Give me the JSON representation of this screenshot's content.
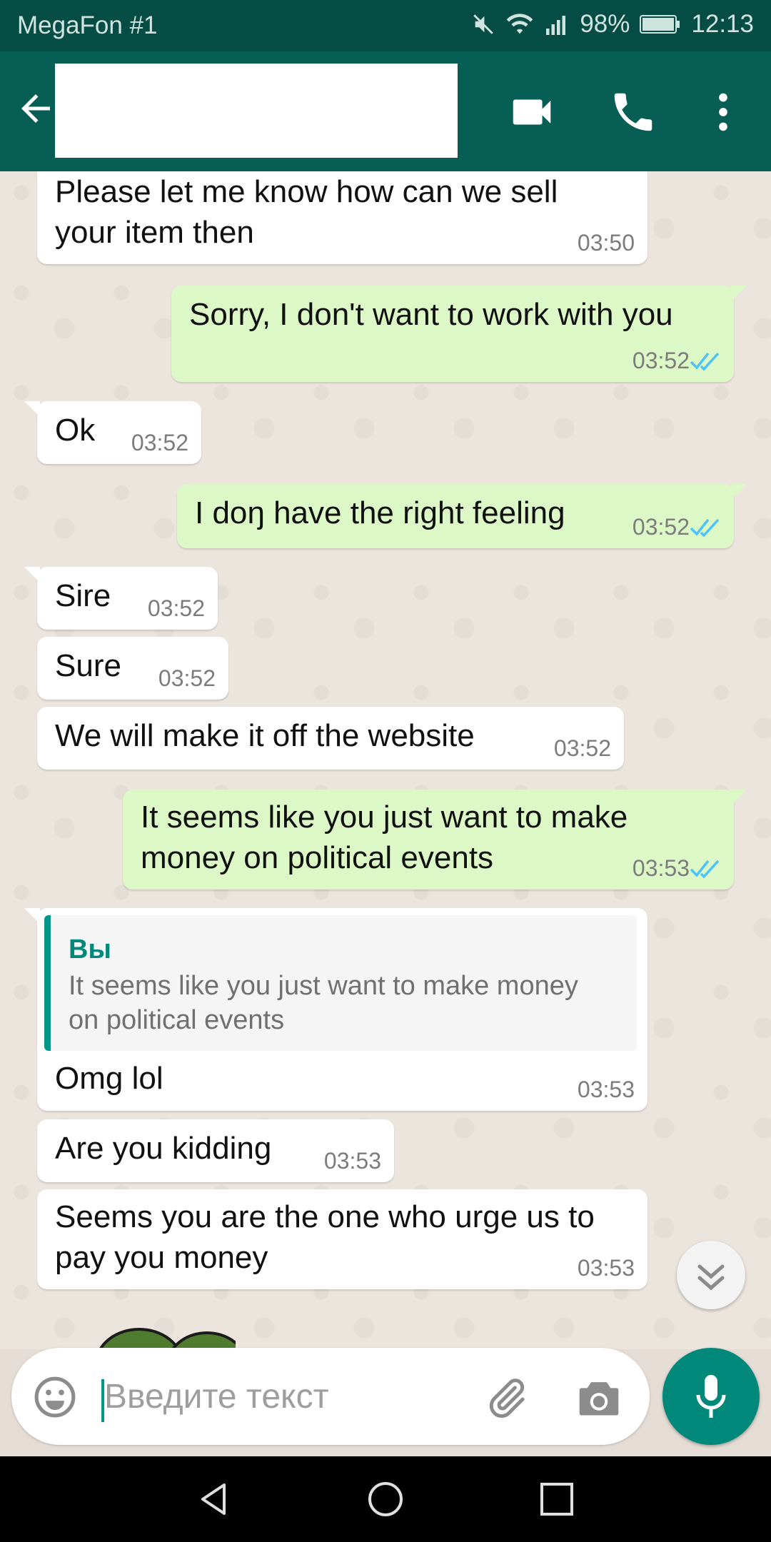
{
  "status_bar": {
    "carrier": "MegaFon #1",
    "battery": "98%",
    "time": "12:13",
    "icons": [
      "mute-icon",
      "wifi-icon",
      "signal-icon",
      "battery-icon"
    ]
  },
  "app_bar": {
    "icons": [
      "back-arrow-icon",
      "video-call-icon",
      "phone-call-icon",
      "more-vert-icon"
    ],
    "colors": {
      "bar": "#075e54",
      "status": "#054d44"
    }
  },
  "messages": [
    {
      "dir": "in",
      "text": [
        "Please let me know how can we sell",
        "your item then"
      ],
      "time": "03:50"
    },
    {
      "dir": "out",
      "text": [
        "Sorry, I don't want to work with you"
      ],
      "time": "03:52",
      "read": true
    },
    {
      "dir": "in",
      "text": [
        "Ok"
      ],
      "time": "03:52"
    },
    {
      "dir": "out",
      "text": [
        "I doŋ have the right feeling"
      ],
      "time": "03:52",
      "read": true
    },
    {
      "dir": "in",
      "text": [
        "Sire"
      ],
      "time": "03:52"
    },
    {
      "dir": "in",
      "text": [
        "Sure"
      ],
      "time": "03:52"
    },
    {
      "dir": "in",
      "text": [
        "We will make it off the website"
      ],
      "time": "03:52"
    },
    {
      "dir": "out",
      "text": [
        "It seems like you just want to make",
        "money on political events"
      ],
      "time": "03:53",
      "read": true
    },
    {
      "dir": "in",
      "quote": {
        "author": "Вы",
        "text": "It seems like you just want to make money on political events"
      },
      "text": [
        "Omg lol"
      ],
      "time": "03:53"
    },
    {
      "dir": "in",
      "text": [
        "Are you kidding"
      ],
      "time": "03:53"
    },
    {
      "dir": "in",
      "text": [
        "Seems you are the one who urge us to",
        "pay you money"
      ],
      "time": "03:53"
    }
  ],
  "composer": {
    "placeholder": "Введите текст",
    "icons": [
      "emoji-icon",
      "attach-icon",
      "camera-icon",
      "mic-icon"
    ]
  },
  "accent": {
    "out_bubble": "#dcf8c6",
    "in_bubble": "#ffffff",
    "tick": "#4fc3f7",
    "teal": "#00897b"
  }
}
